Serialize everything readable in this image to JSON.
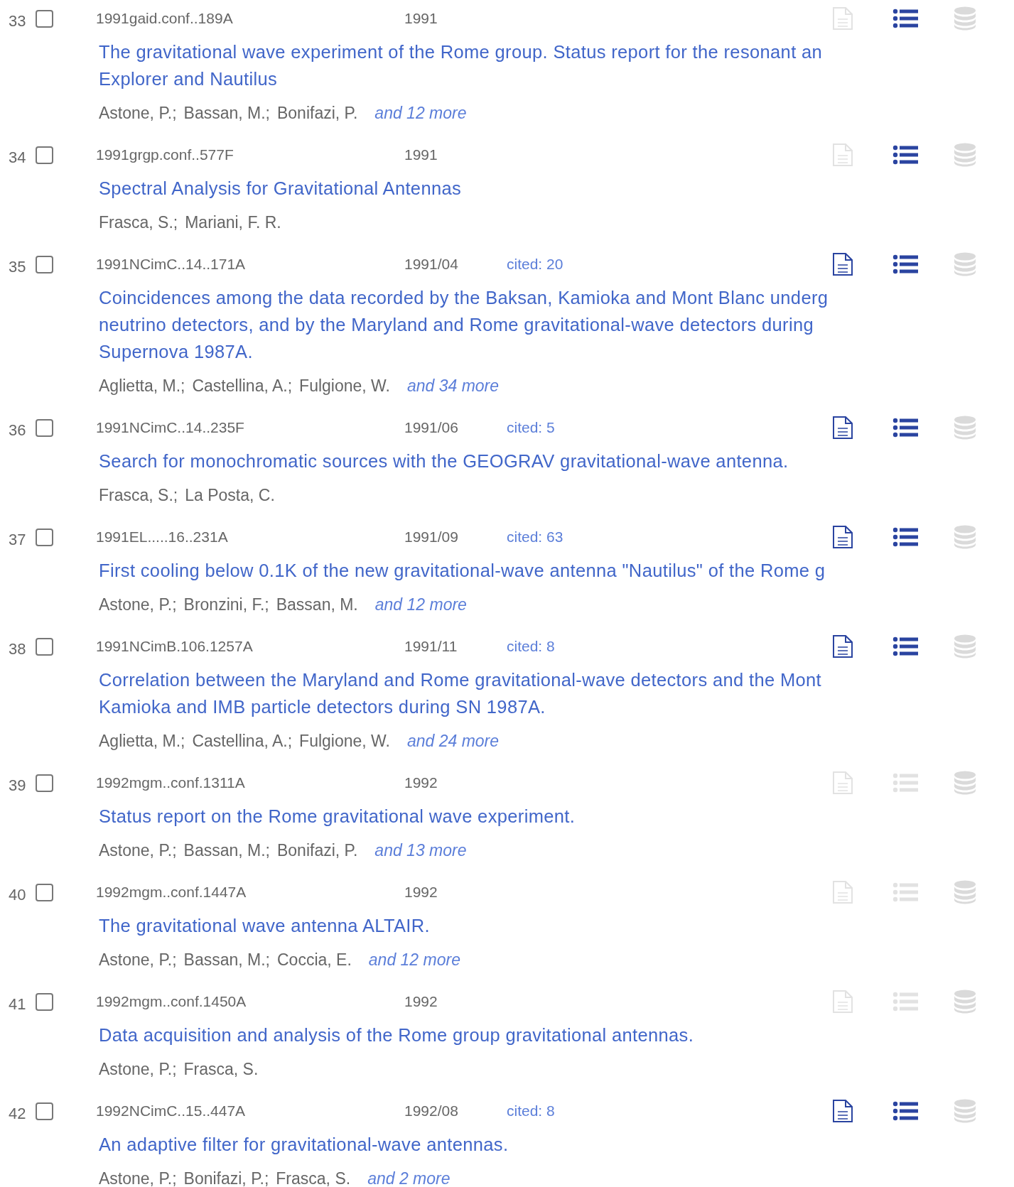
{
  "results": [
    {
      "number": "33",
      "selected": false,
      "bibcode": "1991gaid.conf..189A",
      "date": "1991",
      "title_lines": [
        "The gravitational wave experiment of the Rome group. Status report for the resonant an",
        "Explorer and Nautilus"
      ],
      "authors": [
        "Astone, P.;",
        "Bassan, M.;",
        "Bonifazi, P."
      ],
      "more": "and 12 more",
      "full_text": false,
      "references": true,
      "data": false
    },
    {
      "number": "34",
      "selected": false,
      "bibcode": "1991grgp.conf..577F",
      "date": "1991",
      "title_lines": [
        "Spectral Analysis for Gravitational Antennas"
      ],
      "authors": [
        "Frasca, S.;",
        "Mariani, F. R."
      ],
      "full_text": false,
      "references": true,
      "data": false
    },
    {
      "number": "35",
      "selected": false,
      "bibcode": "1991NCimC..14..171A",
      "date": "1991/04",
      "cited": "cited: 20",
      "title_lines": [
        "Coincidences among the data recorded by the Baksan, Kamioka and Mont Blanc underg",
        "neutrino detectors, and by the Maryland and Rome gravitational-wave detectors during",
        "Supernova 1987A."
      ],
      "authors": [
        "Aglietta, M.;",
        "Castellina, A.;",
        "Fulgione, W."
      ],
      "more": "and 34 more",
      "full_text": true,
      "references": true,
      "data": false
    },
    {
      "number": "36",
      "selected": false,
      "bibcode": "1991NCimC..14..235F",
      "date": "1991/06",
      "cited": "cited: 5",
      "title_lines": [
        "Search for monochromatic sources with the GEOGRAV gravitational-wave antenna."
      ],
      "authors": [
        "Frasca, S.;",
        "La Posta, C."
      ],
      "full_text": true,
      "references": true,
      "data": false
    },
    {
      "number": "37",
      "selected": false,
      "bibcode": "1991EL.....16..231A",
      "date": "1991/09",
      "cited": "cited: 63",
      "title_lines": [
        "First cooling below 0.1K of the new gravitational-wave antenna \"Nautilus\" of the Rome g"
      ],
      "authors": [
        "Astone, P.;",
        "Bronzini, F.;",
        "Bassan, M."
      ],
      "more": "and 12 more",
      "full_text": true,
      "references": true,
      "data": false
    },
    {
      "number": "38",
      "selected": false,
      "bibcode": "1991NCimB.106.1257A",
      "date": "1991/11",
      "cited": "cited: 8",
      "title_lines": [
        "Correlation between the Maryland and Rome gravitational-wave detectors and the Mont",
        "Kamioka and IMB particle detectors during SN 1987A."
      ],
      "authors": [
        "Aglietta, M.;",
        "Castellina, A.;",
        "Fulgione, W."
      ],
      "more": "and 24 more",
      "full_text": true,
      "references": true,
      "data": false
    },
    {
      "number": "39",
      "selected": false,
      "bibcode": "1992mgm..conf.1311A",
      "date": "1992",
      "title_lines": [
        "Status report on the Rome gravitational wave experiment."
      ],
      "authors": [
        "Astone, P.;",
        "Bassan, M.;",
        "Bonifazi, P."
      ],
      "more": "and 13 more",
      "full_text": false,
      "references": false,
      "data": false
    },
    {
      "number": "40",
      "selected": false,
      "bibcode": "1992mgm..conf.1447A",
      "date": "1992",
      "title_lines": [
        "The gravitational wave antenna ALTAIR."
      ],
      "authors": [
        "Astone, P.;",
        "Bassan, M.;",
        "Coccia, E."
      ],
      "more": "and 12 more",
      "full_text": false,
      "references": false,
      "data": false
    },
    {
      "number": "41",
      "selected": false,
      "bibcode": "1992mgm..conf.1450A",
      "date": "1992",
      "title_lines": [
        "Data acquisition and analysis of the Rome group gravitational antennas."
      ],
      "authors": [
        "Astone, P.;",
        "Frasca, S."
      ],
      "full_text": false,
      "references": false,
      "data": false
    },
    {
      "number": "42",
      "selected": false,
      "bibcode": "1992NCimC..15..447A",
      "date": "1992/08",
      "cited": "cited: 8",
      "title_lines": [
        "An adaptive filter for gravitational-wave antennas."
      ],
      "authors": [
        "Astone, P.;",
        "Bonifazi, P.;",
        "Frasca, S."
      ],
      "more": "and 2 more",
      "full_text": true,
      "references": true,
      "data": false
    }
  ]
}
